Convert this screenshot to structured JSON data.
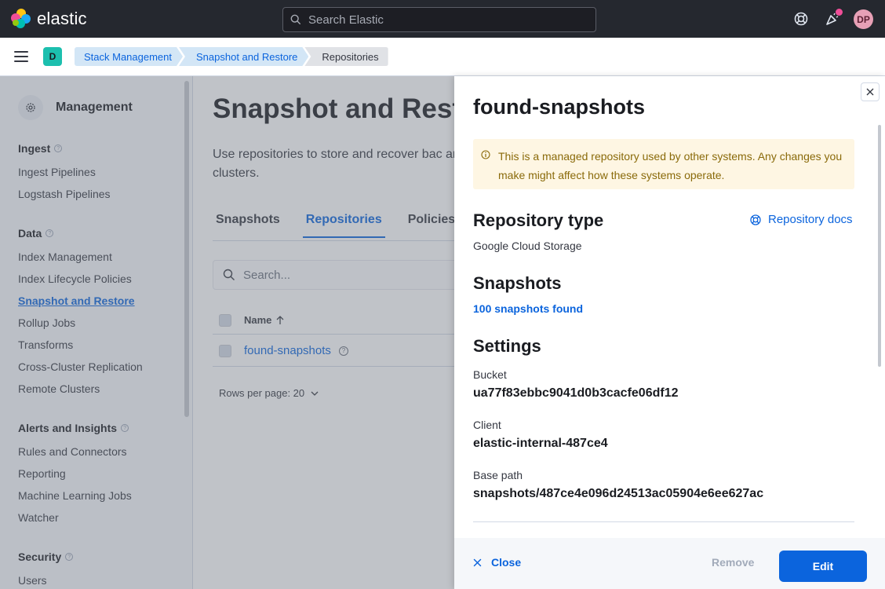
{
  "header": {
    "brand": "elastic",
    "search_placeholder": "Search Elastic",
    "avatar_initials": "DP",
    "avatar_color": "#e7a0b6"
  },
  "breadcrumbs": {
    "space_badge": "D",
    "items": [
      "Stack Management",
      "Snapshot and Restore",
      "Repositories"
    ]
  },
  "sidebar": {
    "title": "Management",
    "sections": [
      {
        "label": "Ingest",
        "items": [
          "Ingest Pipelines",
          "Logstash Pipelines"
        ]
      },
      {
        "label": "Data",
        "items": [
          "Index Management",
          "Index Lifecycle Policies",
          "Snapshot and Restore",
          "Rollup Jobs",
          "Transforms",
          "Cross-Cluster Replication",
          "Remote Clusters"
        ]
      },
      {
        "label": "Alerts and Insights",
        "items": [
          "Rules and Connectors",
          "Reporting",
          "Machine Learning Jobs",
          "Watcher"
        ]
      },
      {
        "label": "Security",
        "items": [
          "Users"
        ]
      }
    ],
    "active_item": "Snapshot and Restore"
  },
  "main": {
    "title": "Snapshot and Rest",
    "description": "Use repositories to store and recover bac and clusters.",
    "tabs": [
      "Snapshots",
      "Repositories",
      "Policies"
    ],
    "selected_tab": "Repositories",
    "search_placeholder": "Search...",
    "column_name": "Name",
    "rows": [
      "found-snapshots"
    ],
    "rows_per_page": "Rows per page: 20"
  },
  "flyout": {
    "title": "found-snapshots",
    "callout": "This is a managed repository used by other systems. Any changes you make might affect how these systems operate.",
    "repo_type_heading": "Repository type",
    "repo_docs_link": "Repository docs",
    "repo_type_value": "Google Cloud Storage",
    "snapshots_heading": "Snapshots",
    "snapshots_link": "100 snapshots found",
    "settings_heading": "Settings",
    "settings": [
      {
        "label": "Bucket",
        "value": "ua77f83ebbc9041d0b3cacfe06df12"
      },
      {
        "label": "Client",
        "value": "elastic-internal-487ce4"
      },
      {
        "label": "Base path",
        "value": "snapshots/487ce4e096d24513ac05904e6ee627ac"
      }
    ],
    "footer": {
      "close_label": "Close",
      "remove_label": "Remove",
      "edit_label": "Edit"
    }
  },
  "colors": {
    "accent": "#0b64dd",
    "header_bg": "#25282f",
    "callout_bg": "#fef6e3"
  }
}
